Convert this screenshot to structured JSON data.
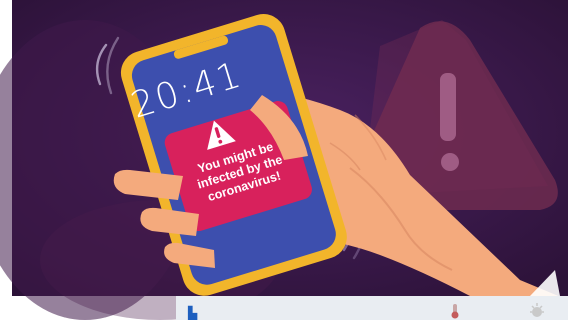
{
  "phone": {
    "time": "20:41"
  },
  "alert": {
    "message": "You might be infected by the coronavirus!",
    "icon": "warning-triangle-icon"
  },
  "colors": {
    "background": "#3b1a4e",
    "phone_frame": "#f2b52b",
    "phone_screen": "#3d4fae",
    "alert_box": "#d8215c",
    "hand": "#f4aa7d",
    "warning_sign": "#6e2a4d"
  }
}
